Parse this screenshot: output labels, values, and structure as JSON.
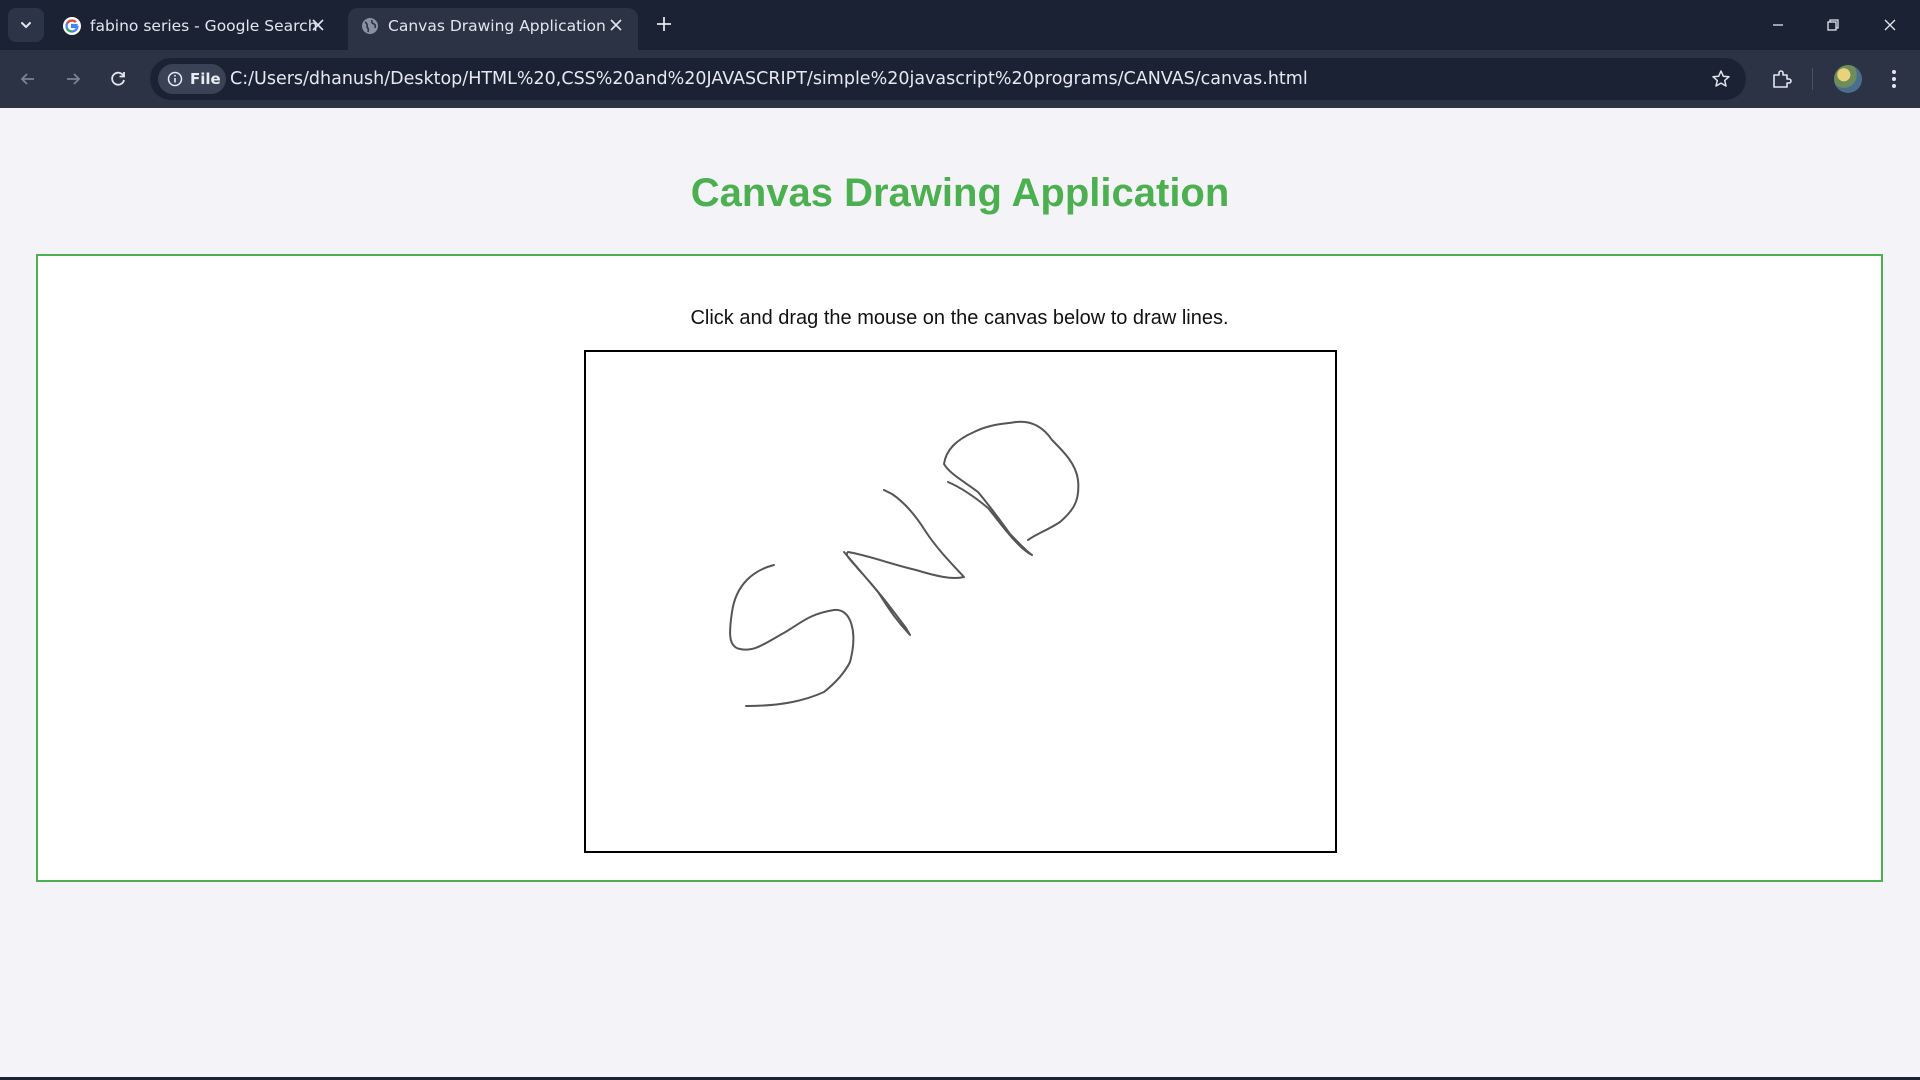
{
  "browser": {
    "tabs": [
      {
        "title": "fabino series - Google Search",
        "active": false,
        "favicon": "google-icon"
      },
      {
        "title": "Canvas Drawing Application",
        "active": true,
        "favicon": "globe-icon"
      }
    ],
    "address_bar": {
      "chip_label": "File",
      "url": "C:/Users/dhanush/Desktop/HTML%20,CSS%20and%20JAVASCRIPT/simple%20javascript%20programs/CANVAS/canvas.html"
    },
    "colors": {
      "tabbar_bg": "#1b2233",
      "toolbar_bg": "#2b3345"
    }
  },
  "page": {
    "title": "Canvas Drawing Application",
    "instructions": "Click and drag the mouse on the canvas below to draw lines.",
    "colors": {
      "accent": "#4caf50",
      "page_bg": "#f4f4f8",
      "canvas_border": "#000000",
      "stroke": "#555555"
    }
  }
}
